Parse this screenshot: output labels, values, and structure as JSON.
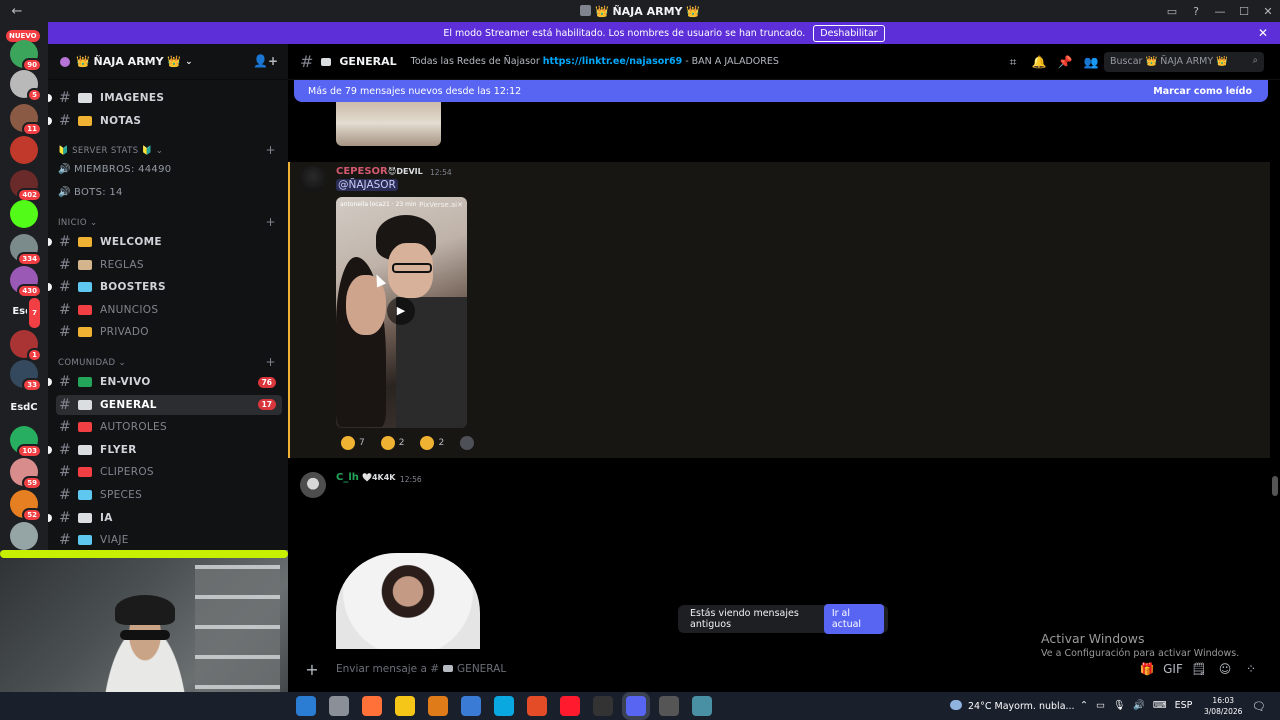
{
  "window": {
    "title": "👑 ÑAJA ARMY 👑",
    "back": "←",
    "controls": [
      "▭",
      "?",
      "—",
      "☐",
      "✕"
    ]
  },
  "streamer_bar": {
    "text": "El modo Streamer está habilitado. Los nombres de usuario se han truncado.",
    "button": "Deshabilitar",
    "close": "✕"
  },
  "rail": {
    "nuevo": "NUEVO",
    "servers": [
      {
        "badge": "90",
        "color": "#3ba55c"
      },
      {
        "badge": "5",
        "color": "#b9b9b9"
      },
      {
        "badge": "11",
        "color": "#8a5a44"
      },
      {
        "badge": "",
        "color": "#c0392b"
      },
      {
        "badge": "402",
        "color": "#6b2a2a"
      },
      {
        "badge": "",
        "color": "#53fc18"
      },
      {
        "badge": "334",
        "color": "#7b8a8b"
      },
      {
        "badge": "430",
        "color": "#9b59b6"
      },
      {
        "text": "Esdi",
        "badge": "7"
      },
      {
        "badge": "1",
        "color": "#a33"
      },
      {
        "badge": "33",
        "color": "#34495e"
      },
      {
        "text": "EsdC",
        "badge": ""
      },
      {
        "badge": "103",
        "color": "#27ae60"
      },
      {
        "badge": "59",
        "color": "#d98c8c"
      },
      {
        "badge": "52",
        "color": "#e67e22"
      },
      {
        "badge": "",
        "color": "#95a5a6"
      }
    ]
  },
  "server": {
    "name": "👑 ÑAJA ARMY 👑",
    "chevron": "⌄",
    "invite_icon": "👤+"
  },
  "sidebar": {
    "channels_top": [
      {
        "name": "IMAGENES",
        "emoji_color": "#dbdee1",
        "unread": true
      },
      {
        "name": "NOTAS",
        "emoji_color": "#f0b232",
        "unread": true
      }
    ],
    "stats_category": "🔰 SERVER STATS 🔰",
    "stats": [
      {
        "icon": "🔊",
        "text": "MIEMBROS: 44490"
      },
      {
        "icon": "🔊",
        "text": "BOTS: 14"
      }
    ],
    "inicio_category": "INICIO",
    "inicio": [
      {
        "name": "WELCOME",
        "emoji": "👋",
        "emoji_color": "#f0b232",
        "muted": false,
        "unread": true
      },
      {
        "name": "REGLAS",
        "emoji": "📜",
        "emoji_color": "#d3b48c",
        "muted": true,
        "icon": "☑"
      },
      {
        "name": "BOOSTERS",
        "emoji": "💎",
        "emoji_color": "#5ec8f0",
        "muted": false,
        "unread": true
      },
      {
        "name": "ANUNCIOS",
        "emoji": "📢",
        "emoji_color": "#f23f43",
        "muted": true,
        "icon": "📣"
      },
      {
        "name": "PRIVADO",
        "emoji": "🔒",
        "emoji_color": "#f0b232",
        "muted": true,
        "icon": "🔊"
      }
    ],
    "comunidad_category": "COMUNIDAD",
    "comunidad": [
      {
        "name": "EN-VIVO",
        "emoji_color": "#23a55a",
        "count": "76",
        "unread": true,
        "icon": "📢"
      },
      {
        "name": "GENERAL",
        "emoji_color": "#dbdee1",
        "count": "17",
        "active": true
      },
      {
        "name": "AUTOROLES",
        "emoji_color": "#f23f43",
        "muted": true
      },
      {
        "name": "FLYER",
        "emoji_color": "#dbdee1",
        "unread": true
      },
      {
        "name": "CLIPEROS",
        "emoji_color": "#f23f43",
        "muted": true
      },
      {
        "name": "SPECES",
        "emoji_color": "#5ec8f0",
        "muted": true
      },
      {
        "name": "IA",
        "emoji_color": "#dbdee1",
        "unread": true
      },
      {
        "name": "VIAJE",
        "emoji_color": "#5ec8f0",
        "muted": true
      }
    ],
    "hash": "#",
    "plus": "+"
  },
  "channel_header": {
    "name": "GENERAL",
    "topic_prefix": "Todas las Redes de Ñajasor",
    "topic_link": "https://linktr.ee/najasor69",
    "topic_suffix": " - BAN A JALADORES",
    "search_placeholder": "Buscar 👑 ÑAJA ARMY 👑",
    "tool_icons": [
      "⌗",
      "🔔",
      "📌",
      "👥"
    ]
  },
  "new_messages_bar": {
    "text": "Más de 79 mensajes nuevos desde las 12:12",
    "mark_read": "Marcar como leído"
  },
  "messages": [
    {
      "author": "CEPESOR",
      "author_color": "#d1586d",
      "role": "😈DEVIL",
      "time": "12:54",
      "mention": "@ÑAJASOR",
      "video_tag": "antonella loca21 · 23 min",
      "video_watermark": "PixVerse.ai✕",
      "reactions": [
        {
          "emoji": "🤣",
          "count": "7"
        },
        {
          "emoji": "😂",
          "count": "2"
        },
        {
          "emoji": "😹",
          "count": "2"
        }
      ]
    },
    {
      "author": "C_lh",
      "author_color": "#23a55a",
      "role": "🤍4K4K",
      "time": "12:56"
    }
  ],
  "old_messages": {
    "text": "Estás viendo mensajes antiguos",
    "button": "Ir al actual"
  },
  "composer": {
    "placeholder_prefix": "Enviar mensaje a #",
    "placeholder_channel": "GENERAL",
    "plus": "+",
    "tools": [
      "🎁",
      "GIF",
      "🗒",
      "☺",
      "⁘"
    ]
  },
  "windows_activation": {
    "line1": "Activar Windows",
    "line2": "Ve a Configuración para activar Windows."
  },
  "taskbar": {
    "apps": [
      {
        "color": "#2b7cd3"
      },
      {
        "color": "#8a8f98"
      },
      {
        "color": "#ff7139"
      },
      {
        "color": "#f5c518"
      },
      {
        "color": "#e07b1a"
      },
      {
        "color": "#3a7bd5"
      },
      {
        "color": "#0aa8e0"
      },
      {
        "color": "#e34c26"
      },
      {
        "color": "#ff1b2d"
      },
      {
        "color": "#333"
      },
      {
        "color": "#5865f2",
        "active": true
      },
      {
        "color": "#555"
      },
      {
        "color": "#4a90a4"
      }
    ],
    "weather": "24°C  Mayorm. nubla...",
    "tray": [
      "⌃",
      "▭",
      "🎙",
      "🔊",
      "⌨",
      "ESP"
    ],
    "time": "16:03",
    "date": "3/08/2026",
    "notif": "🗨"
  }
}
